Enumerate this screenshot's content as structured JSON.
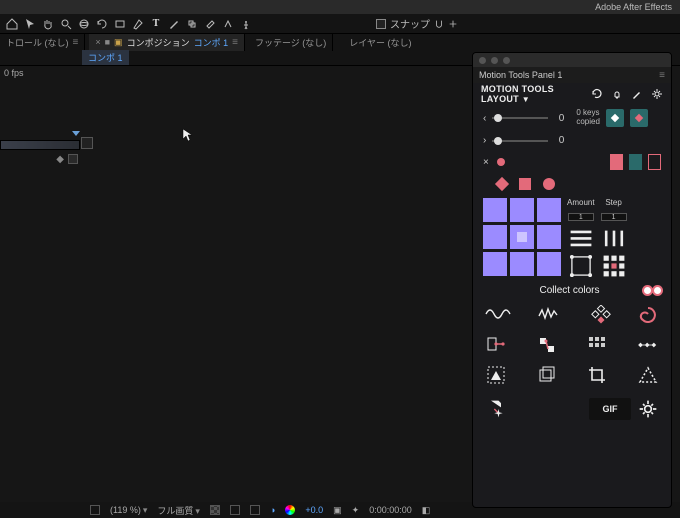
{
  "os": {
    "app_title": "Adobe After Effects"
  },
  "toolbar": {
    "snap_label": "スナップ"
  },
  "panels": {
    "effects_controls": "トロール (なし)",
    "composition_label": "コンポジション",
    "composition_name": "コンポ 1",
    "footage": "フッテージ (なし)",
    "layer": "レイヤー (なし)"
  },
  "subtabs": {
    "comp_link": "コンポ 1"
  },
  "left": {
    "fps": "0 fps"
  },
  "status": {
    "zoom": "(119 %)",
    "res": "フル画質",
    "exposure": "+0.0",
    "time": "0:00:00:00"
  },
  "mt": {
    "panel_title": "Motion Tools Panel 1",
    "header": "MOTION TOOLS LAYOUT",
    "sliders": {
      "a": "0",
      "b": "0"
    },
    "keys_count": "0 keys",
    "keys_state": "copied",
    "amount_label": "Amount",
    "step_label": "Step",
    "amount_value": "1",
    "step_value": "1",
    "collect_label": "Collect colors",
    "gif_label": "GIF"
  }
}
